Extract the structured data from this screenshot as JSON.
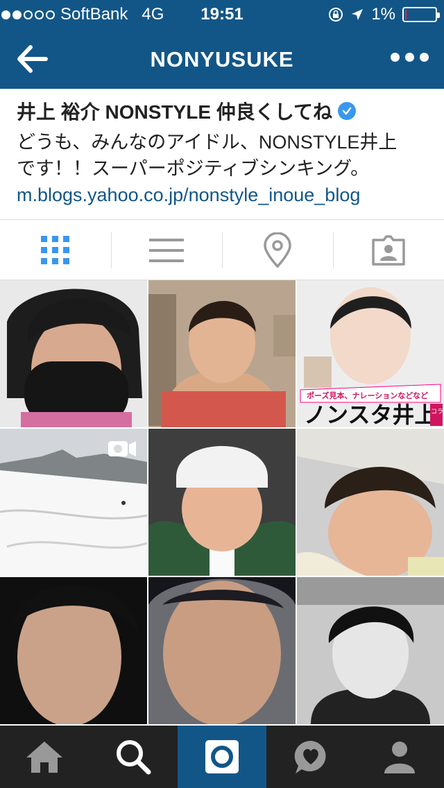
{
  "status_bar": {
    "carrier": "SoftBank",
    "network": "4G",
    "time": "19:51",
    "battery_percent": "1%",
    "battery_level": 0.01,
    "signal_bars": 2
  },
  "navbar": {
    "title": "NONYUSUKE",
    "back_icon": "arrow-left-icon",
    "more_icon": "more-dots-icon"
  },
  "profile": {
    "display_name": "井上 裕介 NONSTYLE 仲良くしてね",
    "verified": true,
    "bio_line1": "どうも、みんなのアイドル、NONSTYLE井上",
    "bio_line2": "です！！スーパーポジティブシンキング。",
    "website": "m.blogs.yahoo.co.jp/nonstyle_inoue_blog"
  },
  "view_tabs": [
    {
      "icon": "grid-icon",
      "active": true
    },
    {
      "icon": "list-icon",
      "active": false
    },
    {
      "icon": "location-pin-icon",
      "active": false
    },
    {
      "icon": "tagged-photos-icon",
      "active": false
    }
  ],
  "posts": [
    {
      "subject": "person-wearing-black-mask",
      "type": "photo"
    },
    {
      "subject": "person-in-towel",
      "type": "photo"
    },
    {
      "subject": "magazine-cover",
      "type": "photo",
      "overlay_text": "ノンスタ井上",
      "banner_text": "ポーズ見本、ナレーションなどなど",
      "side_text": "コラボ"
    },
    {
      "subject": "snowy-ski-slope",
      "type": "video"
    },
    {
      "subject": "person-in-white-beanie",
      "type": "photo"
    },
    {
      "subject": "person-on-airplane",
      "type": "photo"
    },
    {
      "subject": "close-up-face",
      "type": "photo"
    },
    {
      "subject": "close-up-face-2",
      "type": "photo"
    },
    {
      "subject": "black-and-white-portrait",
      "type": "photo"
    }
  ],
  "bottom_nav": [
    {
      "icon": "home-icon",
      "active": false
    },
    {
      "icon": "search-icon",
      "active": false
    },
    {
      "icon": "camera-icon",
      "active": true
    },
    {
      "icon": "activity-heart-icon",
      "active": false
    },
    {
      "icon": "profile-icon",
      "active": false
    }
  ],
  "colors": {
    "header_blue": "#125688",
    "link_blue": "#125688",
    "verified_blue": "#3897f0",
    "active_tab_blue": "#3897f0",
    "inactive_icon_gray": "#999999",
    "bottom_bar": "#222222",
    "battery_red": "#e3253b"
  }
}
